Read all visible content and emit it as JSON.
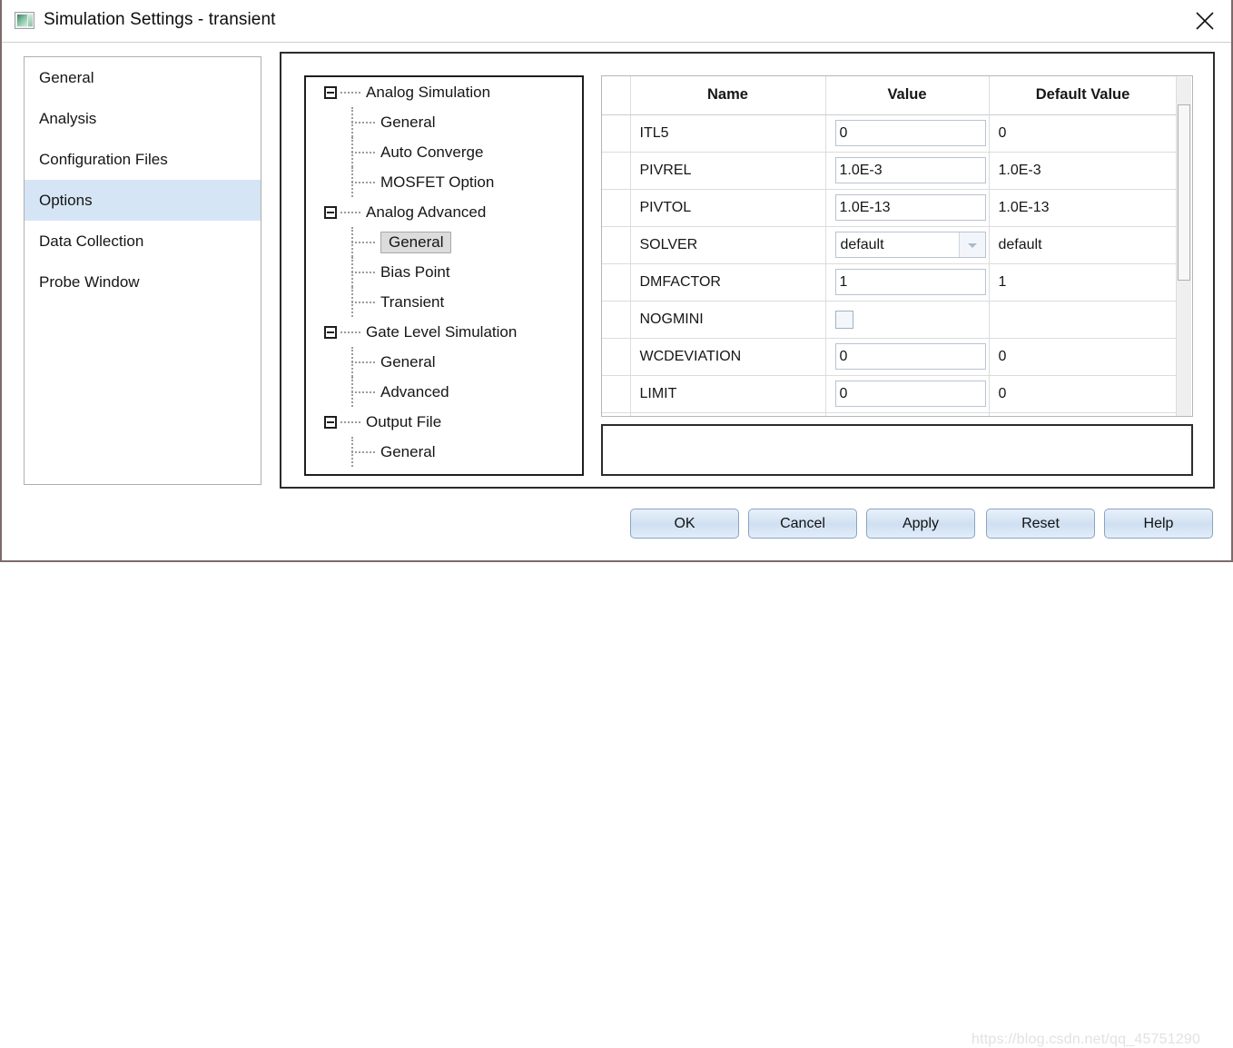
{
  "window": {
    "title": "Simulation Settings - transient",
    "app_icon": "image-thumbnail-icon",
    "close_icon": "close-icon"
  },
  "sidebar": {
    "items": [
      {
        "label": "General",
        "selected": false
      },
      {
        "label": "Analysis",
        "selected": false
      },
      {
        "label": "Configuration Files",
        "selected": false
      },
      {
        "label": "Options",
        "selected": true
      },
      {
        "label": "Data Collection",
        "selected": false
      },
      {
        "label": "Probe Window",
        "selected": false
      }
    ]
  },
  "tree": {
    "nodes": [
      {
        "label": "Analog Simulation",
        "type": "root",
        "expanded": true,
        "selected": false
      },
      {
        "label": "General",
        "type": "child",
        "selected": false
      },
      {
        "label": "Auto Converge",
        "type": "child",
        "selected": false
      },
      {
        "label": "MOSFET Option",
        "type": "child",
        "selected": false
      },
      {
        "label": "Analog Advanced",
        "type": "root",
        "expanded": true,
        "selected": false
      },
      {
        "label": "General",
        "type": "child",
        "selected": true
      },
      {
        "label": "Bias Point",
        "type": "child",
        "selected": false
      },
      {
        "label": "Transient",
        "type": "child",
        "selected": false
      },
      {
        "label": "Gate Level Simulation",
        "type": "root",
        "expanded": true,
        "selected": false
      },
      {
        "label": "General",
        "type": "child",
        "selected": false
      },
      {
        "label": "Advanced",
        "type": "child",
        "selected": false
      },
      {
        "label": "Output File",
        "type": "root",
        "expanded": true,
        "selected": false
      },
      {
        "label": "General",
        "type": "child",
        "selected": false
      }
    ]
  },
  "table": {
    "headers": [
      "",
      "Name",
      "Value",
      "Default Value"
    ],
    "rows": [
      {
        "name": "ITL5",
        "value": "0",
        "editor": "text",
        "default": "0"
      },
      {
        "name": "PIVREL",
        "value": "1.0E-3",
        "editor": "text",
        "default": "1.0E-3"
      },
      {
        "name": "PIVTOL",
        "value": "1.0E-13",
        "editor": "text",
        "default": "1.0E-13"
      },
      {
        "name": "SOLVER",
        "value": "default",
        "editor": "combo",
        "default": "default"
      },
      {
        "name": "DMFACTOR",
        "value": "1",
        "editor": "text",
        "default": "1"
      },
      {
        "name": "NOGMINI",
        "value": "",
        "editor": "checkbox",
        "default": ""
      },
      {
        "name": "WCDEVIATION",
        "value": "0",
        "editor": "text",
        "default": "0"
      },
      {
        "name": "LIMIT",
        "value": "0",
        "editor": "text",
        "default": "0"
      },
      {
        "name": "",
        "value": "",
        "editor": "text",
        "default": ""
      }
    ],
    "scrollbar": {
      "orientation": "vertical",
      "thumb_position": "near-top"
    }
  },
  "description": {
    "text": ""
  },
  "footer": {
    "buttons": [
      {
        "id": "ok",
        "label": "OK"
      },
      {
        "id": "cancel",
        "label": "Cancel"
      },
      {
        "id": "apply",
        "label": "Apply"
      },
      {
        "id": "reset",
        "label": "Reset"
      },
      {
        "id": "help",
        "label": "Help"
      }
    ]
  },
  "watermark": {
    "text": "https://blog.csdn.net/qq_45751290"
  }
}
